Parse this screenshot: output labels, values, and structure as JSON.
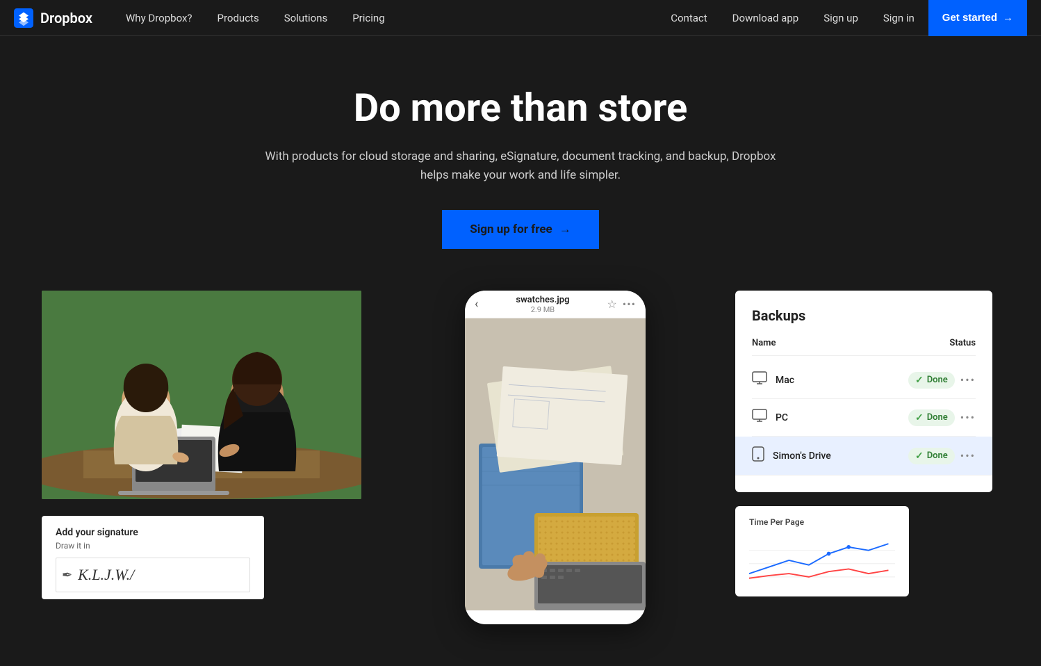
{
  "brand": {
    "name": "Dropbox",
    "logo_icon": "dropbox"
  },
  "nav": {
    "links_left": [
      {
        "label": "Why Dropbox?",
        "id": "why-dropbox"
      },
      {
        "label": "Products",
        "id": "products"
      },
      {
        "label": "Solutions",
        "id": "solutions"
      },
      {
        "label": "Pricing",
        "id": "pricing"
      }
    ],
    "links_right": [
      {
        "label": "Contact",
        "id": "contact"
      },
      {
        "label": "Download app",
        "id": "download-app"
      },
      {
        "label": "Sign up",
        "id": "sign-up"
      },
      {
        "label": "Sign in",
        "id": "sign-in"
      }
    ],
    "cta_label": "Get started",
    "cta_arrow": "→"
  },
  "hero": {
    "headline": "Do more than store",
    "subtext": "With products for cloud storage and sharing, eSignature, document tracking, and backup, Dropbox helps make your work and life simpler.",
    "cta_label": "Sign up for free",
    "cta_arrow": "→"
  },
  "signature_card": {
    "title": "Add your signature",
    "subtitle": "Draw it in",
    "signature_text": "K.L.J.W./"
  },
  "phone_mockup": {
    "back_arrow": "‹",
    "filename": "swatches.jpg",
    "filesize": "2.9 MB",
    "star_icon": "☆",
    "dots_icon": "•••"
  },
  "backup_card": {
    "title": "Backups",
    "col_name": "Name",
    "col_status": "Status",
    "rows": [
      {
        "device": "Mac",
        "icon": "monitor",
        "status": "Done",
        "highlighted": false
      },
      {
        "device": "PC",
        "icon": "monitor",
        "status": "Done",
        "highlighted": false
      },
      {
        "device": "Simon's Drive",
        "icon": "phone",
        "status": "Done",
        "highlighted": true
      }
    ]
  },
  "chart_card": {
    "title": "Time Per Page"
  }
}
